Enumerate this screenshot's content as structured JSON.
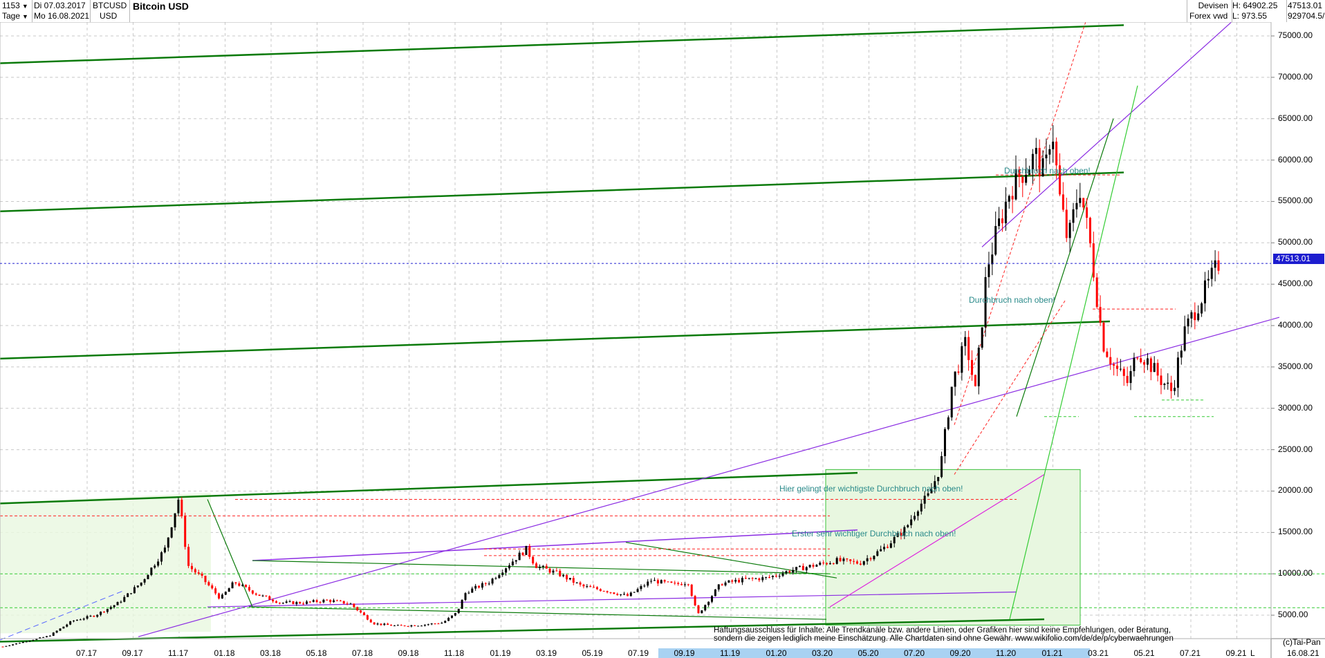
{
  "header": {
    "count": "1153",
    "period": "Tage",
    "date_from": "Di 07.03.2017",
    "date_to": "Mo 16.08.2021",
    "symbol": "BTCUSD",
    "currency": "USD",
    "title": "Bitcoin USD",
    "category": "Devisen",
    "source": "Forex vwd",
    "high_label": "H: 64902.25",
    "low_label": "L: 973.55",
    "last_value": "47513.01",
    "volume_value": "929704.5/"
  },
  "colors": {
    "candle_up": "#000000",
    "candle_down": "#ff0000",
    "trend_green": "#0a7a0a",
    "channel_purple": "#8a2be2",
    "price_line": "#1d1dcf",
    "grid": "#c8c8c8"
  },
  "annotations": {
    "durchbruch_1": "Durchbruch nach oben!",
    "durchbruch_2": "Durchbruch nach oben!",
    "wichtigste": "Hier gelingt der wichtigste Durchbruch nach oben!",
    "erster": "Erster sehr wichtiger Durchbruch nach oben!"
  },
  "disclaimer": {
    "line1": "Haftungsausschluss für Inhalte: Alle Trendkanäle bzw. andere Linien, oder Grafiken hier sind keine Empfehlungen, oder Beratung,",
    "line2": "sondern die zeigen lediglich meine  Einschätzung. Alle Chartdaten sind ohne Gewähr.  www.wikifolio.com/de/de/p/cyberwaehrungen"
  },
  "footer": {
    "copyright": "(c)Tai-Pan",
    "date": "16.08.21",
    "mode": "L"
  },
  "chart_data": {
    "type": "candlestick",
    "title": "Bitcoin USD",
    "y_ticks": [
      "75000.00",
      "70000.00",
      "65000.00",
      "60000.00",
      "55000.00",
      "50000.00",
      "45000.00",
      "40000.00",
      "35000.00",
      "30000.00",
      "25000.00",
      "20000.00",
      "15000.00",
      "10000.00",
      "5000.00"
    ],
    "y_tick_values": [
      75000,
      70000,
      65000,
      60000,
      55000,
      50000,
      45000,
      40000,
      35000,
      30000,
      25000,
      20000,
      15000,
      10000,
      5000
    ],
    "x_ticks": [
      "07.17",
      "09.17",
      "11.17",
      "01.18",
      "03.18",
      "05.18",
      "07.18",
      "09.18",
      "11.18",
      "01.19",
      "03.19",
      "05.19",
      "07.19",
      "09.19",
      "11.19",
      "01.20",
      "03.20",
      "05.20",
      "07.20",
      "09.20",
      "11.20",
      "01.21",
      "03.21",
      "05.21",
      "07.21",
      "09.21"
    ],
    "ylim": [
      0,
      78000
    ],
    "grid": true,
    "last_price": 47513.01,
    "high": 64902.25,
    "low": 973.55,
    "price_path": [
      [
        0,
        1200
      ],
      [
        2,
        2500
      ],
      [
        3,
        4300
      ],
      [
        4,
        5000
      ],
      [
        5,
        6500
      ],
      [
        6,
        9000
      ],
      [
        7,
        13000
      ],
      [
        7.6,
        19200
      ],
      [
        8,
        11000
      ],
      [
        8.6,
        9500
      ],
      [
        9.4,
        7000
      ],
      [
        10,
        9000
      ],
      [
        11,
        7500
      ],
      [
        12,
        6500
      ],
      [
        13,
        6500
      ],
      [
        14,
        6800
      ],
      [
        15,
        6400
      ],
      [
        16,
        4000
      ],
      [
        17,
        3700
      ],
      [
        18,
        3800
      ],
      [
        19,
        4100
      ],
      [
        19.6,
        5300
      ],
      [
        20,
        7800
      ],
      [
        21,
        9000
      ],
      [
        22,
        11500
      ],
      [
        22.6,
        13000
      ],
      [
        23,
        11000
      ],
      [
        24,
        10000
      ],
      [
        25,
        8500
      ],
      [
        26,
        8000
      ],
      [
        27,
        7300
      ],
      [
        28,
        9200
      ],
      [
        29,
        8700
      ],
      [
        29.6,
        9000
      ],
      [
        30,
        5000
      ],
      [
        31,
        8800
      ],
      [
        32,
        9300
      ],
      [
        33,
        9500
      ],
      [
        34,
        10400
      ],
      [
        35,
        11000
      ],
      [
        36,
        11600
      ],
      [
        37,
        11300
      ],
      [
        38,
        13000
      ],
      [
        39,
        15500
      ],
      [
        39.5,
        18000
      ],
      [
        40,
        19500
      ],
      [
        40.5,
        23000
      ],
      [
        41,
        33000
      ],
      [
        41.6,
        38000
      ],
      [
        42,
        32000
      ],
      [
        42.5,
        47000
      ],
      [
        43,
        52000
      ],
      [
        43.5,
        56500
      ],
      [
        44,
        58500
      ],
      [
        44.6,
        60500
      ],
      [
        45,
        58000
      ],
      [
        45.3,
        64700
      ],
      [
        45.6,
        56000
      ],
      [
        46,
        50000
      ],
      [
        46.5,
        57000
      ],
      [
        47,
        49000
      ],
      [
        47.5,
        38000
      ],
      [
        48,
        35000
      ],
      [
        48.6,
        33000
      ],
      [
        49,
        37000
      ],
      [
        49.5,
        35500
      ],
      [
        50,
        33500
      ],
      [
        50.5,
        32000
      ],
      [
        51,
        39000
      ],
      [
        51.5,
        42000
      ],
      [
        52,
        44600
      ],
      [
        52.5,
        47513
      ]
    ]
  }
}
